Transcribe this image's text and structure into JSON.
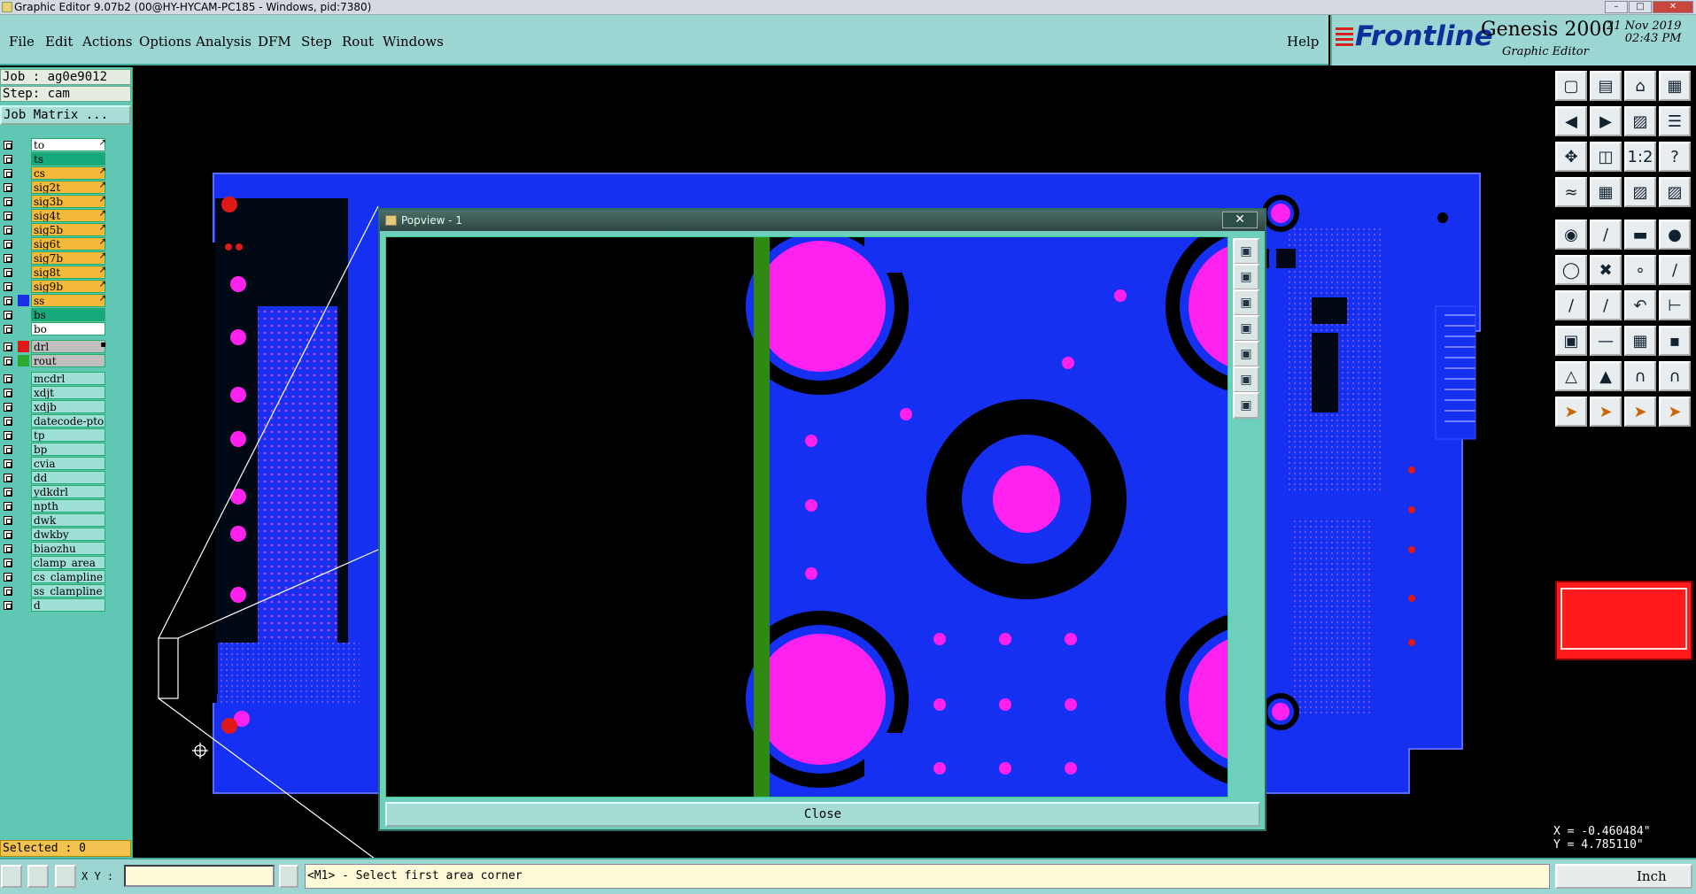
{
  "window": {
    "title": "Graphic Editor 9.07b2 (00@HY-HYCAM-PC185 - Windows, pid:7380)"
  },
  "menu": [
    "File",
    "Edit",
    "Actions",
    "Options",
    "Analysis",
    "DFM",
    "Step",
    "Rout",
    "Windows"
  ],
  "help_label": "Help",
  "logo": {
    "brand": "Frontline",
    "product": "Genesis 2000",
    "subtitle": "Graphic Editor",
    "date": "21 Nov 2019",
    "time": "02:43 PM"
  },
  "job": {
    "job_label": "Job : ag0e9012",
    "step_label": "Step: cam",
    "matrix_button": "Job Matrix ..."
  },
  "layers": [
    {
      "name": "to",
      "bg": "#ffffff",
      "flag": "↗"
    },
    {
      "name": "ts",
      "bg": "#17a87c",
      "flag": ""
    },
    {
      "name": "cs",
      "bg": "#f4b93a",
      "flag": "↗"
    },
    {
      "name": "sig2t",
      "bg": "#f4b93a",
      "flag": "↗"
    },
    {
      "name": "sig3b",
      "bg": "#f4b93a",
      "flag": "↗"
    },
    {
      "name": "sig4t",
      "bg": "#f4b93a",
      "flag": "↗"
    },
    {
      "name": "sig5b",
      "bg": "#f4b93a",
      "flag": "↗"
    },
    {
      "name": "sig6t",
      "bg": "#f4b93a",
      "flag": "↗"
    },
    {
      "name": "sig7b",
      "bg": "#f4b93a",
      "flag": "↗"
    },
    {
      "name": "sig8t",
      "bg": "#f4b93a",
      "flag": "↗"
    },
    {
      "name": "sig9b",
      "bg": "#f4b93a",
      "flag": "↗"
    },
    {
      "name": "ss",
      "bg": "#f4b93a",
      "flag": "↗",
      "swatch": "#1a2fe6"
    },
    {
      "name": "bs",
      "bg": "#17a87c",
      "flag": ""
    },
    {
      "name": "bo",
      "bg": "#ffffff",
      "flag": ""
    },
    {
      "name": "drl",
      "bg": "#bfbfbf",
      "flag": "▪",
      "swatch": "#e01818",
      "gap": true
    },
    {
      "name": "rout",
      "bg": "#bfbfbf",
      "flag": "",
      "swatch": "#2fa82f"
    },
    {
      "name": "mcdrl",
      "bg": "#9ee0d6",
      "flag": "",
      "gap": true
    },
    {
      "name": "xdjt",
      "bg": "#9ee0d6",
      "flag": ""
    },
    {
      "name": "xdjb",
      "bg": "#9ee0d6",
      "flag": ""
    },
    {
      "name": "datecode-pto",
      "bg": "#9ee0d6",
      "flag": ""
    },
    {
      "name": "tp",
      "bg": "#9ee0d6",
      "flag": ""
    },
    {
      "name": "bp",
      "bg": "#9ee0d6",
      "flag": ""
    },
    {
      "name": "cvia",
      "bg": "#9ee0d6",
      "flag": ""
    },
    {
      "name": "dd",
      "bg": "#9ee0d6",
      "flag": ""
    },
    {
      "name": "ydkdrl",
      "bg": "#9ee0d6",
      "flag": ""
    },
    {
      "name": "npth",
      "bg": "#9ee0d6",
      "flag": ""
    },
    {
      "name": "dwk",
      "bg": "#9ee0d6",
      "flag": ""
    },
    {
      "name": "dwkby",
      "bg": "#9ee0d6",
      "flag": ""
    },
    {
      "name": "biaozhu",
      "bg": "#9ee0d6",
      "flag": ""
    },
    {
      "name": "clamp_area",
      "bg": "#9ee0d6",
      "flag": ""
    },
    {
      "name": "cs_clampline",
      "bg": "#9ee0d6",
      "flag": ""
    },
    {
      "name": "ss_clampline",
      "bg": "#9ee0d6",
      "flag": ""
    },
    {
      "name": "d",
      "bg": "#9ee0d6",
      "flag": ""
    }
  ],
  "selected_label": "Selected : 0",
  "popview": {
    "title": "Popview - 1",
    "close_label": "Close"
  },
  "status": {
    "xy_label": "X Y :",
    "hint": "<M1> - Select first area corner",
    "units": "Inch"
  },
  "coords": {
    "x": "X = -0.460484\"",
    "y": "Y = 4.785110\""
  },
  "colors": {
    "board": "#1530f0",
    "pad": "#ff22ee",
    "drill": "#e01818",
    "rout": "#2f8a12",
    "panel": "#5fc7b4"
  }
}
